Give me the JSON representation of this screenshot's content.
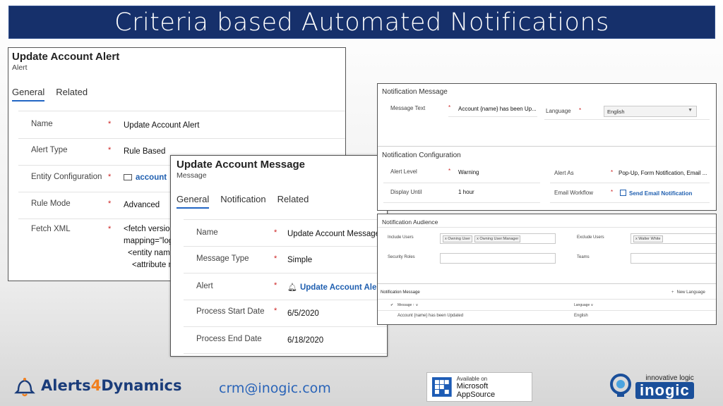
{
  "slide_title": "Criteria based Automated Notifications",
  "alert_form": {
    "title": "Update Account Alert",
    "subtitle": "Alert",
    "tabs": [
      {
        "label": "General",
        "active": true
      },
      {
        "label": "Related",
        "active": false
      }
    ],
    "fields": [
      {
        "label": "Name",
        "value": "Update Account Alert"
      },
      {
        "label": "Alert Type",
        "value": "Rule Based"
      },
      {
        "label": "Entity Configuration",
        "value": "account"
      },
      {
        "label": "Rule Mode",
        "value": "Advanced"
      },
      {
        "label": "Fetch XML",
        "lines": [
          "<fetch version",
          "mapping=\"log",
          "<entity name",
          "<attribute n"
        ]
      }
    ],
    "required_mark": "*"
  },
  "message_form": {
    "title": "Update Account Message",
    "subtitle": "Message",
    "tabs": [
      {
        "label": "General",
        "active": true
      },
      {
        "label": "Notification",
        "active": false
      },
      {
        "label": "Related",
        "active": false
      }
    ],
    "fields": [
      {
        "label": "Name",
        "value": "Update Account Message",
        "required": true
      },
      {
        "label": "Message Type",
        "value": "Simple",
        "required": true
      },
      {
        "label": "Alert",
        "value": "Update Account Alert",
        "required": true
      },
      {
        "label": "Process Start Date",
        "value": "6/5/2020",
        "required": true
      },
      {
        "label": "Process End Date",
        "value": "6/18/2020",
        "required": false
      }
    ]
  },
  "notification_panel": {
    "message_section_title": "Notification Message",
    "message_text_label": "Message Text",
    "message_text_value": "Account {name} has been Up...",
    "language_label": "Language",
    "language_value": "English",
    "config_section_title": "Notification Configuration",
    "alert_level_label": "Alert Level",
    "alert_level_value": "Warning",
    "display_until_label": "Display Until",
    "display_until_value": "1 hour",
    "alert_as_label": "Alert As",
    "alert_as_value": "Pop-Up, Form Notification, Email ...",
    "email_workflow_label": "Email Workflow",
    "email_workflow_value": "Send Email Notification"
  },
  "audience_panel": {
    "section_title": "Notification Audience",
    "include_users_label": "Include Users",
    "include_users_tags": [
      "x Owning User",
      "x Owning User:Manager"
    ],
    "exclude_users_label": "Exclude Users",
    "exclude_users_tags": [
      "x Walter White"
    ],
    "security_roles_label": "Security Roles",
    "teams_label": "Teams",
    "grid_title": "Notification Message",
    "new_language_label": "New Language",
    "columns": [
      "Message ↑ ∨",
      "Language ∨"
    ],
    "rows": [
      {
        "message": "Account {name} has been Updated",
        "language": "English"
      }
    ]
  },
  "footer": {
    "brand_left": "Alerts",
    "brand_num": "4",
    "brand_right": "Dynamics",
    "email": "crm@inogic.com",
    "appsource_line1": "Available on",
    "appsource_line2": "Microsoft AppSource",
    "inogic_tagline": "innovative logic",
    "inogic_name": "inogic"
  },
  "colors": {
    "title_bar": "#16306b",
    "link": "#1f5fb0",
    "required": "#cc2222",
    "tab_underline": "#2266c4"
  }
}
